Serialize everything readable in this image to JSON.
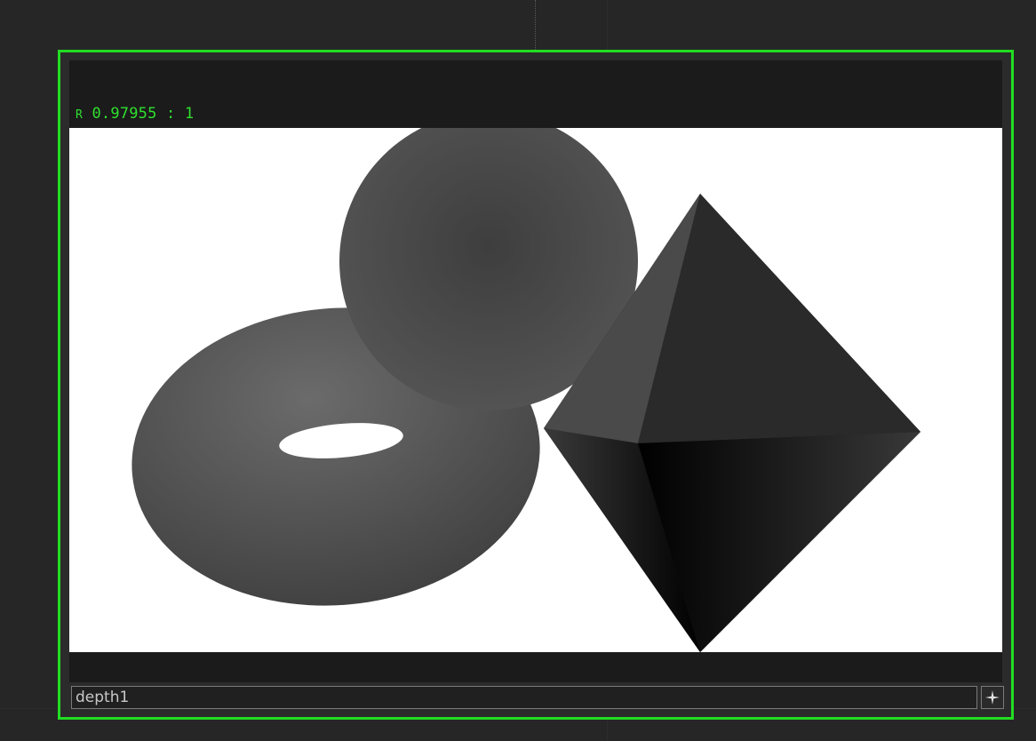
{
  "viewer": {
    "info_channel": "R",
    "info_value": "0.97955 : 1"
  },
  "node": {
    "name_value": "depth1"
  },
  "icons": {
    "pin": "sparkle-pin-icon"
  },
  "colors": {
    "selection_border": "#22dd22",
    "info_text": "#2ee02e",
    "background": "#262626"
  }
}
